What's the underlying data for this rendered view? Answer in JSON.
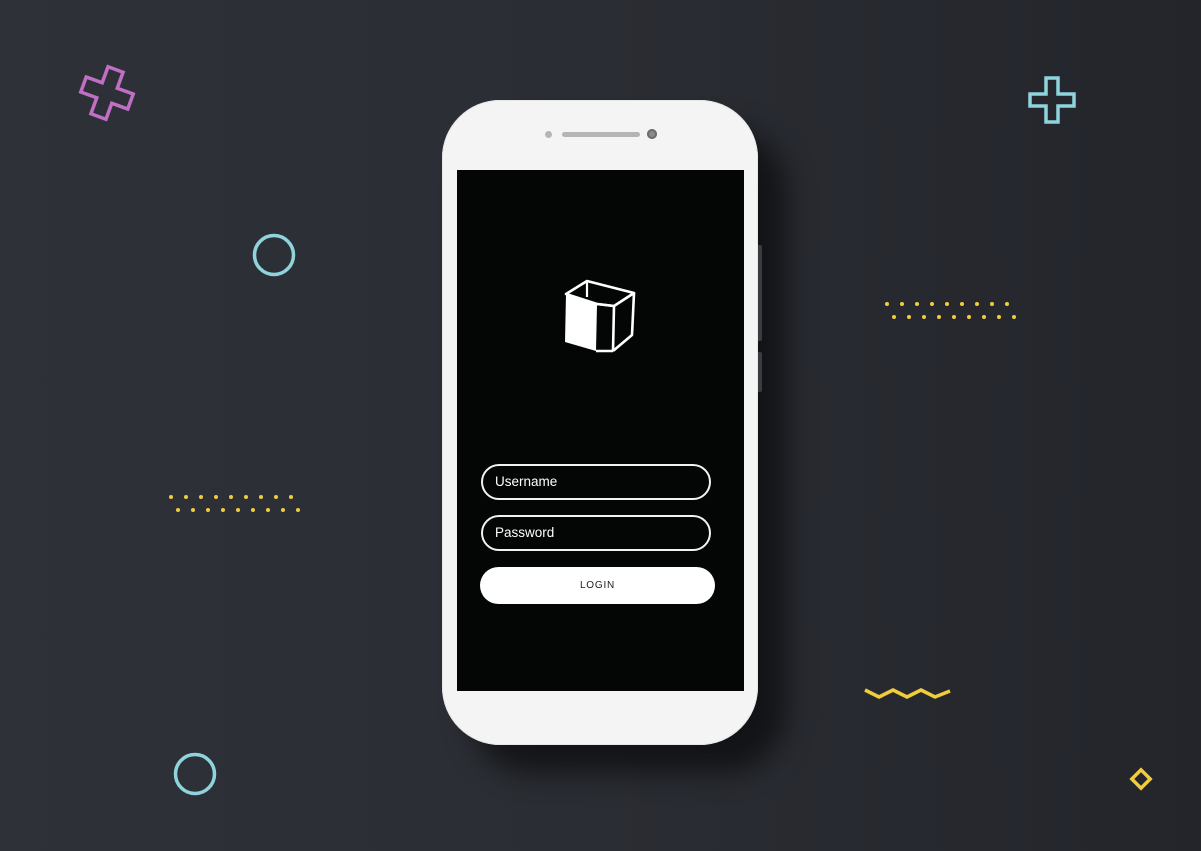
{
  "login_screen": {
    "username_placeholder": "Username",
    "password_placeholder": "Password",
    "login_label": "LOGIN"
  },
  "colors": {
    "background": "#2a2d33",
    "phone_body": "#f4f4f4",
    "screen": "#040606",
    "pink": "#c06fc4",
    "cyan": "#8fd3dc",
    "yellow": "#f1cc3b"
  },
  "icons": {
    "logo": "open-cube-icon",
    "decorations": [
      "plus-icon",
      "plus-icon",
      "circle-icon",
      "circle-icon",
      "dotted-line",
      "dotted-line",
      "zigzag-line",
      "diamond-icon"
    ]
  }
}
